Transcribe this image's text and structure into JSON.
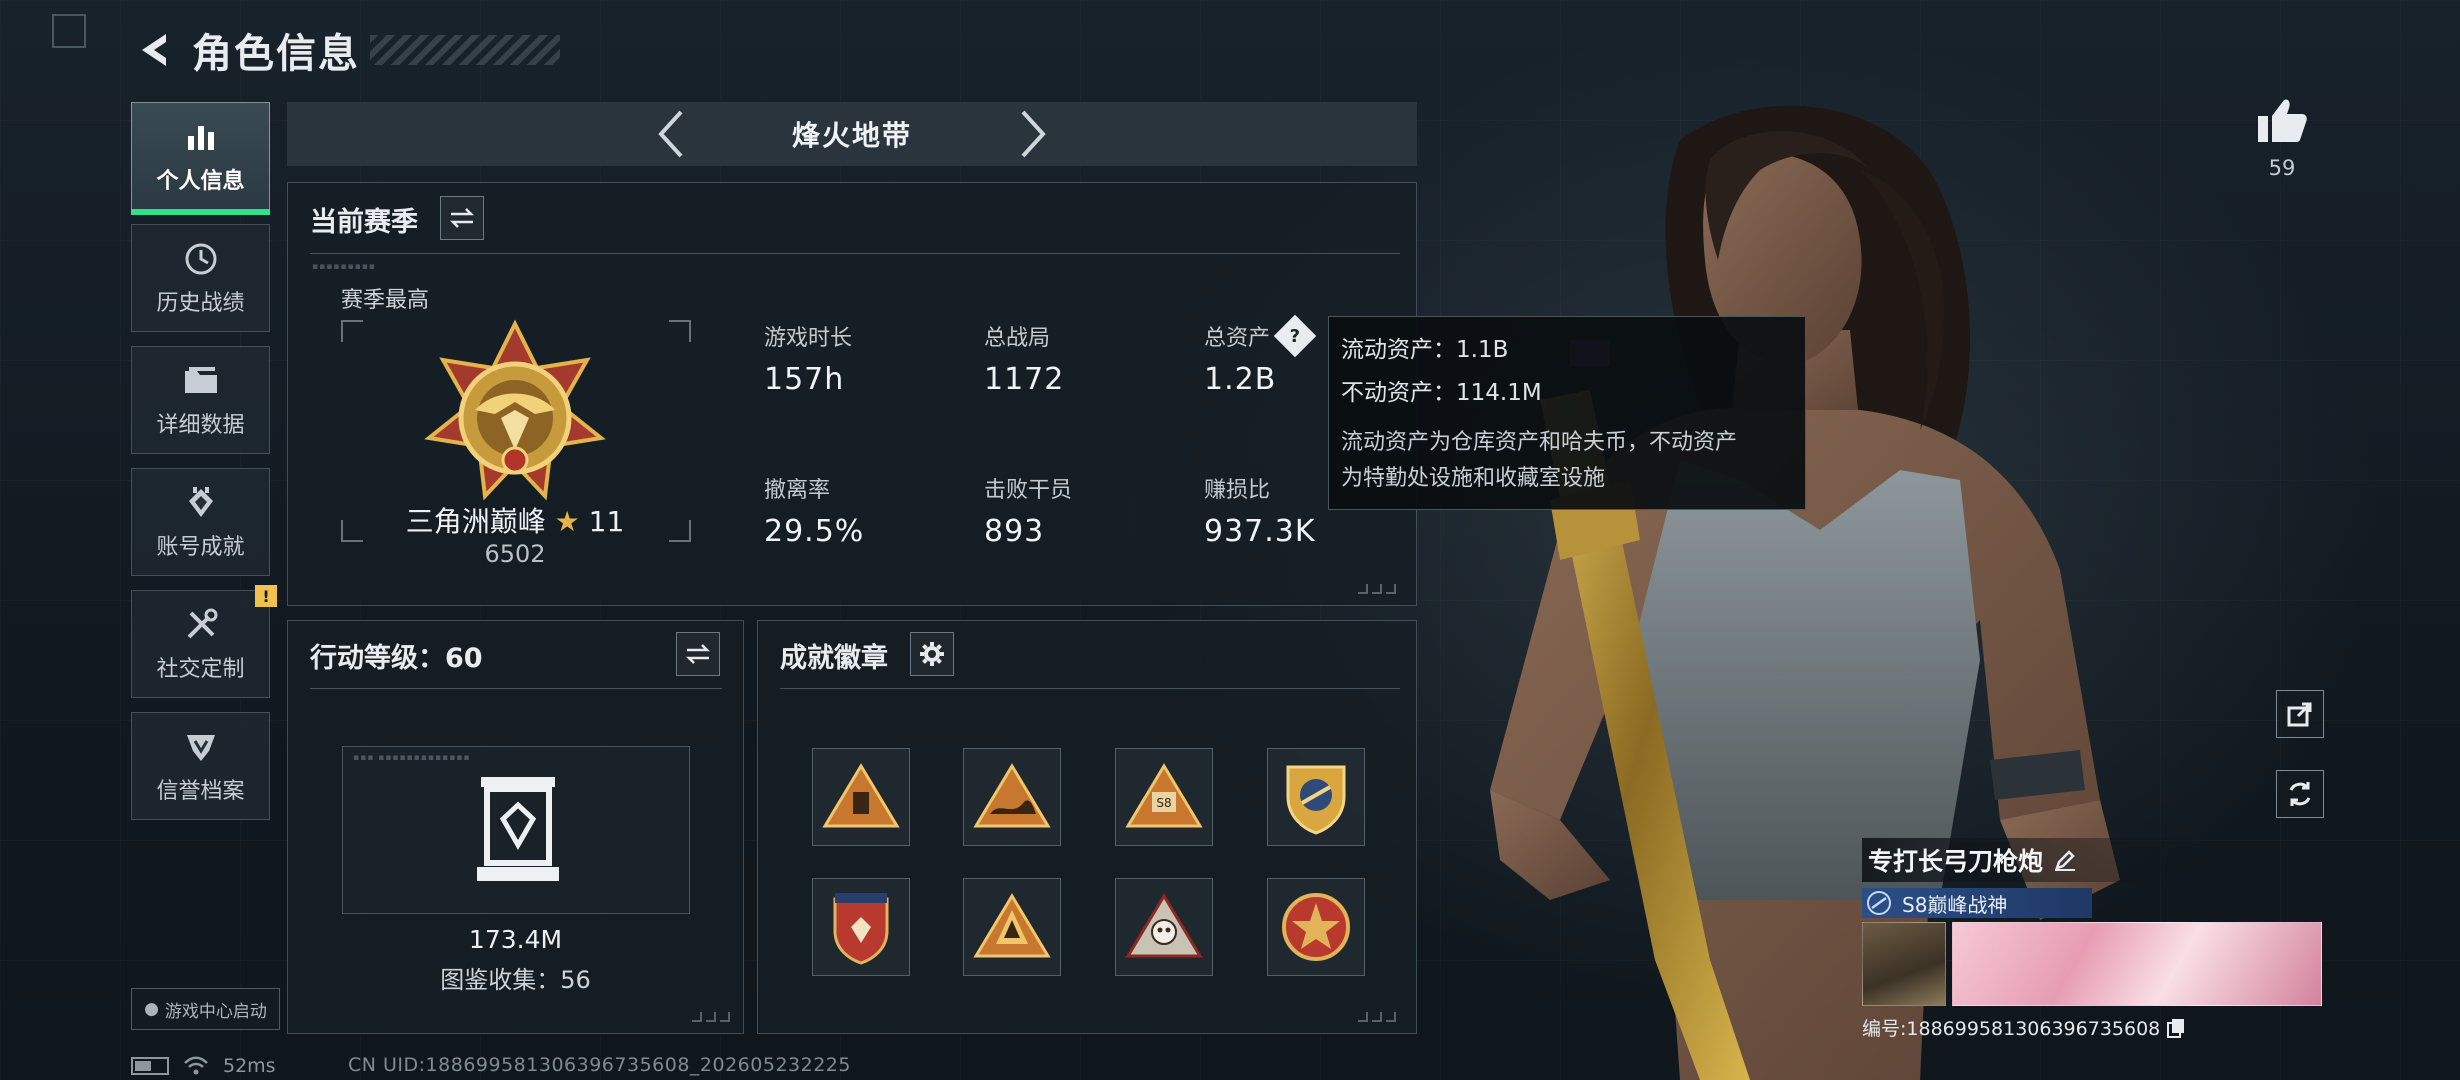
{
  "header": {
    "title": "角色信息"
  },
  "sidebar": {
    "items": [
      {
        "label": "个人信息",
        "icon": "bar-chart-icon",
        "active": true
      },
      {
        "label": "历史战绩",
        "icon": "history-icon"
      },
      {
        "label": "详细数据",
        "icon": "folder-icon"
      },
      {
        "label": "账号成就",
        "icon": "achievement-icon"
      },
      {
        "label": "社交定制",
        "icon": "tools-icon",
        "badge": "!"
      },
      {
        "label": "信誉档案",
        "icon": "credit-icon"
      }
    ],
    "launch_label": "游戏中心启动"
  },
  "mode": {
    "title": "烽火地带"
  },
  "season": {
    "title": "当前赛季",
    "best_label": "赛季最高",
    "rank_name": "三角洲巅峰",
    "rank_star": "★",
    "rank_stars": "11",
    "rank_score": "6502",
    "stats": [
      {
        "label": "游戏时长",
        "value": "157h"
      },
      {
        "label": "总战局",
        "value": "1172"
      },
      {
        "label": "总资产",
        "value": "1.2B",
        "help": "?"
      },
      {
        "label": "撤离率",
        "value": "29.5%"
      },
      {
        "label": "击败干员",
        "value": "893"
      },
      {
        "label": "赚损比",
        "value": "937.3K"
      }
    ]
  },
  "tooltip": {
    "liquid": "流动资产：1.1B",
    "fixed": "不动资产：114.1M",
    "desc_1": "流动资产为仓库资产和哈夫币，不动资产",
    "desc_2": "为特勤处设施和收藏室设施"
  },
  "action": {
    "title": "行动等级：60",
    "collection_value": "173.4M",
    "collection_label": "图鉴收集：56"
  },
  "achievements": {
    "title": "成就徽章",
    "badges": [
      {
        "icon": "supply-triangle-badge",
        "color": "#c8772e"
      },
      {
        "icon": "wave-triangle-badge",
        "color": "#c8772e"
      },
      {
        "icon": "s8-triangle-badge",
        "color": "#c8772e"
      },
      {
        "icon": "shield-crest-badge",
        "color": "#d9a640"
      },
      {
        "icon": "star-shield-badge",
        "color": "#b83a2e"
      },
      {
        "icon": "peak-triangle-badge",
        "color": "#c8772e"
      },
      {
        "icon": "skull-triangle-badge",
        "color": "#c9c3b6"
      },
      {
        "icon": "star-medal-badge",
        "color": "#b83a2e"
      }
    ]
  },
  "profile": {
    "likes": "59",
    "player_name": "专打长弓刀枪炮",
    "title_badge": "S8巅峰战神",
    "uid_line": "编号:18869958130639673560​8"
  },
  "status": {
    "ping": "52ms",
    "uid_footer": "CN UID:188699581306396735608_202605232225"
  },
  "colors": {
    "accent": "#2fe18a",
    "warn": "#f2c14b",
    "gold": "#e6b34a"
  }
}
